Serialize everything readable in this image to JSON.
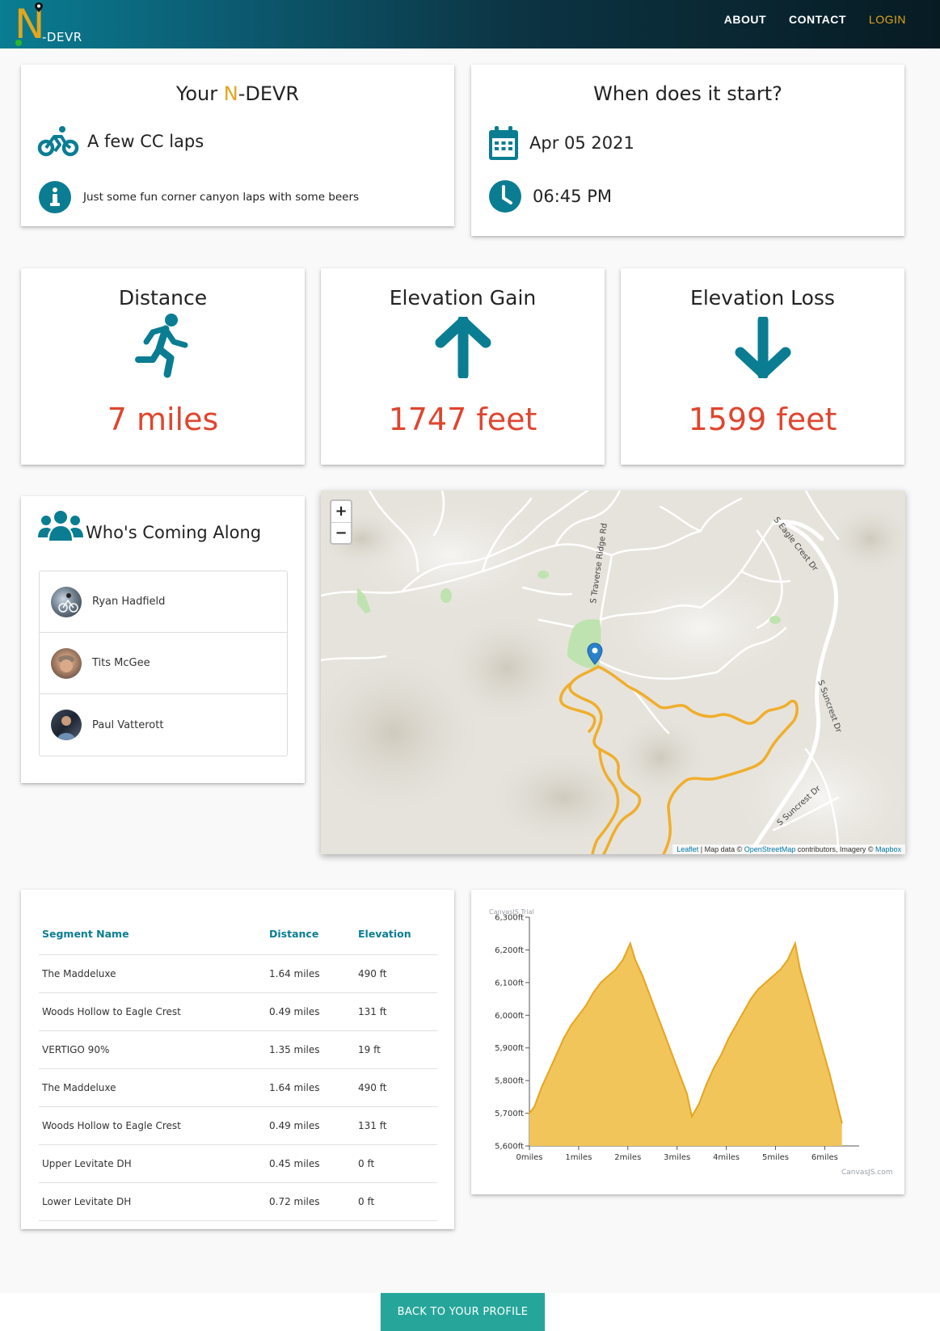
{
  "nav": {
    "logo_letter": "N",
    "logo_text": "-DEVR",
    "links": [
      {
        "label": "ABOUT"
      },
      {
        "label": "CONTACT"
      },
      {
        "label": "LOGIN"
      }
    ]
  },
  "ride": {
    "title_prefix": "Your ",
    "title_accent": "N",
    "title_suffix": "-DEVR",
    "name": "A few CC laps",
    "description": "Just some fun corner canyon laps with some beers",
    "icons": [
      "bike-icon",
      "info-icon"
    ]
  },
  "schedule": {
    "title": "When does it start?",
    "date": "Apr 05 2021",
    "time": "06:45 PM",
    "icons": [
      "calendar-icon",
      "clock-icon"
    ]
  },
  "stats": [
    {
      "title": "Distance",
      "value": "7 miles",
      "icon": "running-icon"
    },
    {
      "title": "Elevation Gain",
      "value": "1747 feet",
      "icon": "arrow-up-icon"
    },
    {
      "title": "Elevation Loss",
      "value": "1599 feet",
      "icon": "arrow-down-icon"
    }
  ],
  "attendees": {
    "title": "Who's Coming Along",
    "people": [
      {
        "name": "Ryan Hadfield"
      },
      {
        "name": "Tits McGee"
      },
      {
        "name": "Paul Vatterott"
      }
    ]
  },
  "map": {
    "zoom_in": "+",
    "zoom_out": "−",
    "labels": [
      "S Traverse Ridge Rd",
      "S Eagle Crest Dr",
      "S Suncrest Dr",
      "S Suncrest Dr"
    ],
    "attribution": {
      "leaflet": "Leaflet",
      "sep1": " | Map data © ",
      "osm": "OpenStreetMap",
      "sep2": " contributors, Imagery © ",
      "mapbox": "Mapbox"
    },
    "route_color": "#f0ae2b"
  },
  "segments": {
    "headers": [
      "Segment Name",
      "Distance",
      "Elevation"
    ],
    "rows": [
      [
        "The Maddeluxe",
        "1.64 miles",
        "490 ft"
      ],
      [
        "Woods Hollow to Eagle Crest",
        "0.49 miles",
        "131 ft"
      ],
      [
        "VERTIGO 90%",
        "1.35 miles",
        "19 ft"
      ],
      [
        "The Maddeluxe",
        "1.64 miles",
        "490 ft"
      ],
      [
        "Woods Hollow to Eagle Crest",
        "0.49 miles",
        "131 ft"
      ],
      [
        "Upper Levitate DH",
        "0.45 miles",
        "0 ft"
      ],
      [
        "Lower Levitate DH",
        "0.72 miles",
        "0 ft"
      ]
    ]
  },
  "chart_data": {
    "type": "area",
    "watermark_top": "CanvasJS Trial",
    "watermark_bottom": "CanvasJS.com",
    "ylim": [
      5600,
      6300
    ],
    "yticks": [
      "5,600ft",
      "5,700ft",
      "5,800ft",
      "5,900ft",
      "6,000ft",
      "6,100ft",
      "6,200ft",
      "6,300ft"
    ],
    "xticks": [
      "0miles",
      "1miles",
      "2miles",
      "3miles",
      "4miles",
      "5miles",
      "6miles"
    ],
    "fill": "#f2c55a",
    "stroke": "#e6a51f",
    "x": [
      0,
      0.1,
      0.25,
      0.4,
      0.55,
      0.7,
      0.85,
      1.0,
      1.15,
      1.3,
      1.45,
      1.6,
      1.75,
      1.9,
      2.05,
      2.15,
      2.3,
      2.45,
      2.6,
      2.75,
      2.9,
      3.05,
      3.2,
      3.3,
      3.45,
      3.6,
      3.75,
      3.9,
      4.05,
      4.2,
      4.35,
      4.5,
      4.65,
      4.8,
      4.95,
      5.1,
      5.25,
      5.4,
      5.5,
      5.65,
      5.8,
      5.95,
      6.1,
      6.25,
      6.35
    ],
    "y": [
      5700,
      5720,
      5780,
      5830,
      5880,
      5930,
      5970,
      6000,
      6030,
      6070,
      6100,
      6120,
      6140,
      6170,
      6220,
      6170,
      6120,
      6060,
      6000,
      5940,
      5880,
      5820,
      5760,
      5690,
      5730,
      5790,
      5840,
      5880,
      5930,
      5970,
      6010,
      6050,
      6080,
      6100,
      6120,
      6140,
      6170,
      6220,
      6140,
      6060,
      5980,
      5900,
      5820,
      5730,
      5670
    ]
  },
  "back_button": "BACK TO YOUR PROFILE"
}
